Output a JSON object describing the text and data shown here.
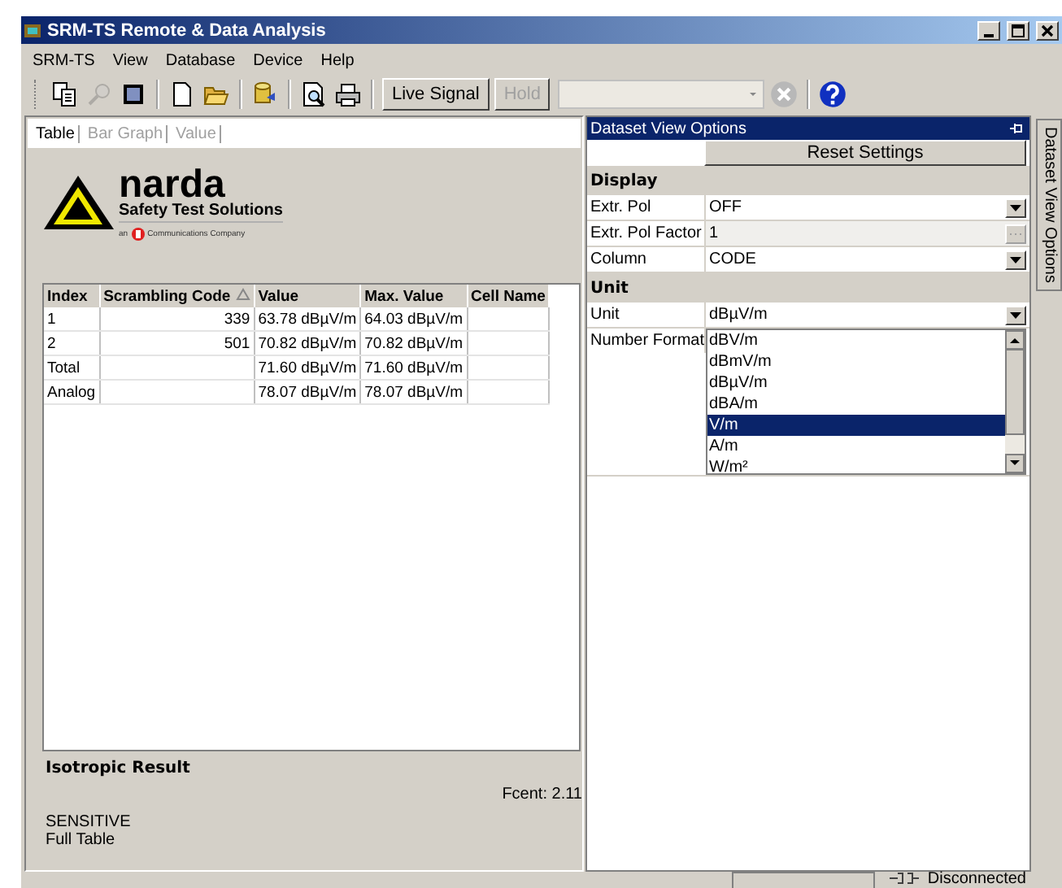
{
  "window": {
    "title": "SRM-TS Remote & Data Analysis"
  },
  "menu": [
    {
      "label": "SRM-TS"
    },
    {
      "label": "View"
    },
    {
      "label": "Database"
    },
    {
      "label": "Device"
    },
    {
      "label": "Help"
    }
  ],
  "toolbar": {
    "icon_buttons": [
      {
        "disabled": false
      },
      {
        "disabled": true
      },
      {
        "disabled": false
      },
      {
        "disabled": false
      },
      {
        "disabled": false
      },
      {
        "disabled": false
      },
      {
        "disabled": false
      },
      {
        "disabled": false
      }
    ],
    "buttons": [
      {
        "label": "Live Signal",
        "disabled": false
      },
      {
        "label": "Hold",
        "disabled": true
      }
    ],
    "device_combo": {
      "disabled": true
    },
    "stop": {
      "disabled": true
    }
  },
  "tabs": [
    {
      "label": "Table",
      "selected": true
    },
    {
      "label": "Bar Graph",
      "selected": false
    },
    {
      "label": "Value",
      "selected": false
    }
  ],
  "logo": {
    "name": "narda",
    "tagline": "Safety Test Solutions",
    "company_prefix": "an",
    "company": "Communications Company"
  },
  "table": {
    "columns": [
      {
        "label": "Index",
        "sorted": false
      },
      {
        "label": "Scrambling Code",
        "sorted": true
      },
      {
        "label": "Value",
        "sorted": false
      },
      {
        "label": "Max. Value",
        "sorted": false
      },
      {
        "label": "Cell Name",
        "sorted": false
      }
    ],
    "rows": [
      {
        "kind": "data",
        "cells": [
          "1",
          "339",
          "63.78 dBµV/m",
          "64.03 dBµV/m",
          ""
        ]
      },
      {
        "kind": "data",
        "cells": [
          "2",
          "501",
          "70.82 dBµV/m",
          "70.82 dBµV/m",
          ""
        ]
      },
      {
        "kind": "summary",
        "cells": [
          "Total",
          "",
          "71.60 dBµV/m",
          "71.60 dBµV/m",
          ""
        ]
      },
      {
        "kind": "summary",
        "cells": [
          "Analog",
          "",
          "78.07 dBµV/m",
          "78.07 dBµV/m",
          ""
        ]
      }
    ]
  },
  "result": {
    "title": "Isotropic Result",
    "fcent": "Fcent:  2.11",
    "mode": "SENSITIVE",
    "view": "Full Table"
  },
  "options_panel": {
    "title": "Dataset View Options",
    "reset": "Reset Settings",
    "sections": [
      {
        "title": "Display",
        "rows": [
          {
            "label": "Extr. Pol",
            "value": "OFF",
            "kind": "dropdown",
            "disabled": false
          },
          {
            "label": "Extr. Pol Factor",
            "value": "1",
            "kind": "ellipsis",
            "disabled": true
          },
          {
            "label": "Column",
            "value": "CODE",
            "kind": "dropdown",
            "disabled": false
          }
        ]
      },
      {
        "title": "Unit",
        "rows": [
          {
            "label": "Unit",
            "value": "dBµV/m",
            "kind": "dropdown",
            "disabled": false
          },
          {
            "label": "Number Format",
            "kind": "list",
            "options": [
              {
                "label": "dBV/m",
                "selected": false
              },
              {
                "label": "dBmV/m",
                "selected": false
              },
              {
                "label": "dBµV/m",
                "selected": false
              },
              {
                "label": "dBA/m",
                "selected": false
              },
              {
                "label": "V/m",
                "selected": true
              },
              {
                "label": "A/m",
                "selected": false
              },
              {
                "label": "W/m²",
                "selected": false
              }
            ]
          }
        ]
      }
    ]
  },
  "side_tab": {
    "label": "Dataset View Options"
  },
  "status_bar": {
    "connection": "Disconnected"
  }
}
